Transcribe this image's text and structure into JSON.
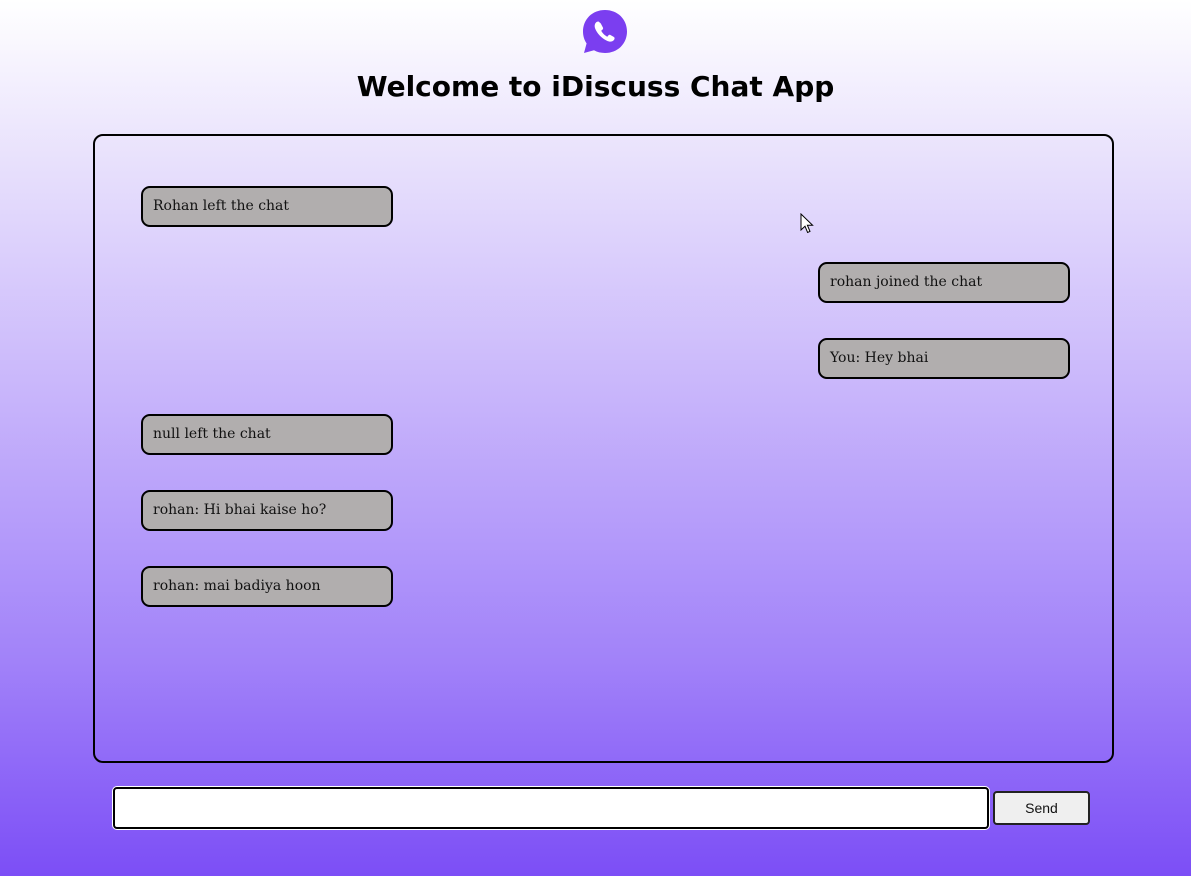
{
  "header": {
    "logo_icon": "whatsapp-phone-icon",
    "title": "Welcome to iDiscuss Chat App"
  },
  "chat": {
    "messages": [
      {
        "text": "Rohan left the chat",
        "side": "left"
      },
      {
        "text": "rohan joined the chat",
        "side": "right"
      },
      {
        "text": "You: Hey bhai",
        "side": "right"
      },
      {
        "text": "null left the chat",
        "side": "left"
      },
      {
        "text": "rohan: Hi bhai kaise ho?",
        "side": "left"
      },
      {
        "text": "rohan: mai badiya hoon",
        "side": "left"
      }
    ]
  },
  "composer": {
    "input_value": "",
    "send_label": "Send"
  },
  "colors": {
    "accent": "#7c4ef6",
    "bubble": "#b1aeae",
    "logo": "#7b3ef0"
  }
}
